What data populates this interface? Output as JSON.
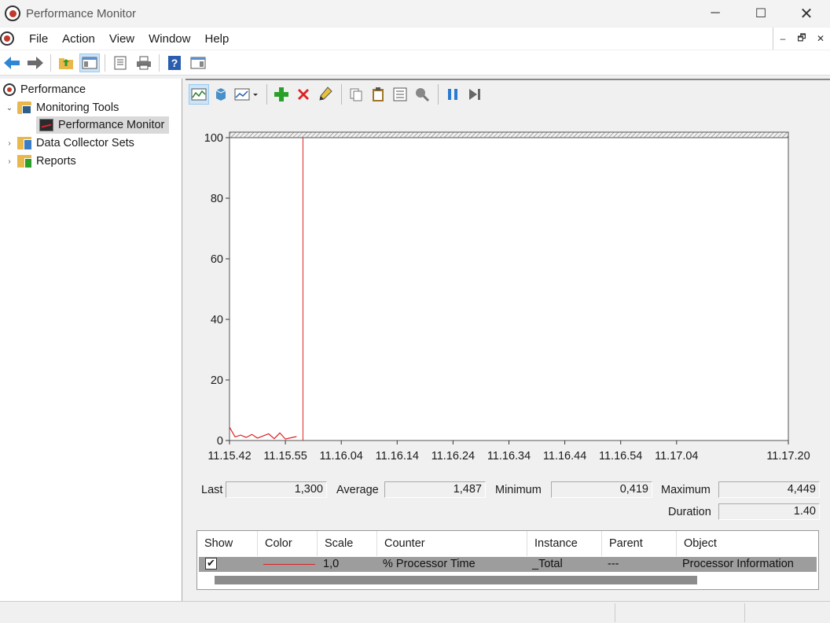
{
  "window": {
    "title": "Performance Monitor",
    "minimize_glyph": "─",
    "maximize_glyph": "☐",
    "close_glyph": "✕"
  },
  "menu": {
    "items": [
      "File",
      "Action",
      "View",
      "Window",
      "Help"
    ],
    "mdi_min": "–",
    "mdi_restore": "🗗",
    "mdi_close": "✕"
  },
  "toolbar": {
    "icons": [
      "back-arrow-icon",
      "forward-arrow-icon",
      "up-folder-icon",
      "show-hide-tree-icon",
      "properties-icon",
      "print-icon",
      "help-icon",
      "show-hide-action-pane-icon"
    ]
  },
  "tree": {
    "root": "Performance",
    "items": [
      {
        "label": "Monitoring Tools",
        "expanded": true
      },
      {
        "label": "Performance Monitor",
        "selected": true
      },
      {
        "label": "Data Collector Sets",
        "expanded": false
      },
      {
        "label": "Reports",
        "expanded": false
      }
    ],
    "expanded_glyph": "⌄",
    "collapsed_glyph": "›"
  },
  "graph_toolbar": {
    "icons": [
      "view-current-activity-icon",
      "view-log-data-icon",
      "change-graph-type-icon",
      "add-counter-icon",
      "delete-counter-icon",
      "highlight-icon",
      "copy-properties-icon",
      "paste-counter-list-icon",
      "properties-icon",
      "zoom-icon",
      "freeze-display-icon",
      "update-data-icon"
    ]
  },
  "chart_data": {
    "type": "line",
    "title": "",
    "ylim": [
      0,
      100
    ],
    "yticks": [
      0,
      20,
      40,
      60,
      80,
      100
    ],
    "xtick_labels": [
      "11.15.42",
      "11.15.55",
      "11.16.04",
      "11.16.14",
      "11.16.24",
      "11.16.34",
      "11.16.44",
      "11.16.54",
      "11.17.04",
      "11.17.20"
    ],
    "series": [
      {
        "name": "% Processor Time",
        "color": "#dd2222",
        "values": [
          4.4,
          1.2,
          1.8,
          1.0,
          2.0,
          0.8,
          1.5,
          2.2,
          0.6,
          2.5,
          0.5,
          0.9,
          1.3
        ]
      }
    ],
    "current_position_index": 13,
    "grid": false
  },
  "stats": {
    "last_label": "Last",
    "last_value": "1,300",
    "average_label": "Average",
    "average_value": "1,487",
    "minimum_label": "Minimum",
    "minimum_value": "0,419",
    "maximum_label": "Maximum",
    "maximum_value": "4,449",
    "duration_label": "Duration",
    "duration_value": "1.40"
  },
  "counters": {
    "headers": [
      "Show",
      "Color",
      "Scale",
      "Counter",
      "Instance",
      "Parent",
      "Object"
    ],
    "rows": [
      {
        "show": "✔",
        "color": "#dd2222",
        "scale": "1,0",
        "counter": "% Processor Time",
        "instance": "_Total",
        "parent": "---",
        "object": "Processor Information"
      }
    ]
  }
}
